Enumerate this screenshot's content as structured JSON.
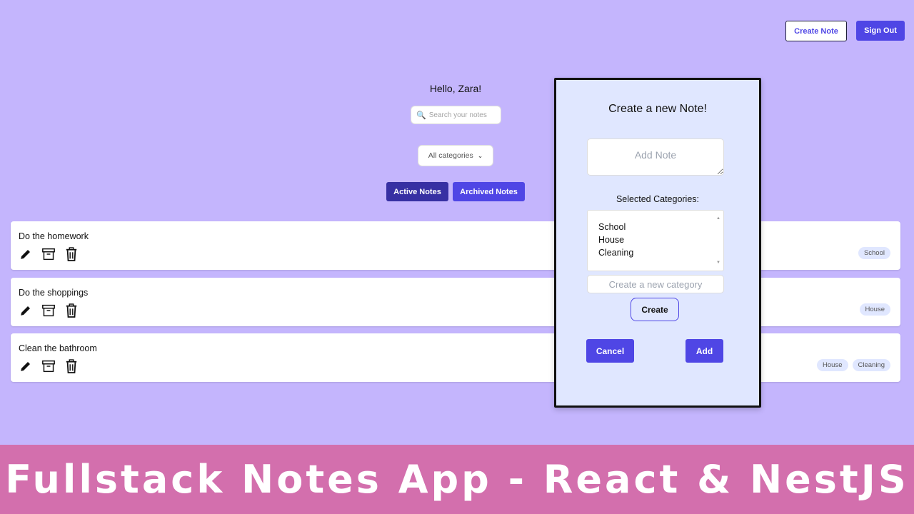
{
  "header": {
    "create_note_label": "Create Note",
    "sign_out_label": "Sign Out"
  },
  "greeting": "Hello, Zara!",
  "search": {
    "placeholder": "Search your notes",
    "icon": "search-icon"
  },
  "category_filter": {
    "selected": "All categories"
  },
  "tabs": [
    {
      "label": "Active Notes",
      "active": true
    },
    {
      "label": "Archived Notes",
      "active": false
    }
  ],
  "notes": [
    {
      "title": "Do the homework",
      "tags": [
        "School"
      ]
    },
    {
      "title": "Do the shoppings",
      "tags": [
        "House"
      ]
    },
    {
      "title": "Clean the bathroom",
      "tags": [
        "House",
        "Cleaning"
      ]
    }
  ],
  "modal": {
    "title": "Create a new Note!",
    "note_placeholder": "Add Note",
    "categories_label": "Selected Categories:",
    "categories": [
      "School",
      "House",
      "Cleaning"
    ],
    "new_category_placeholder": "Create a new category",
    "create_label": "Create",
    "cancel_label": "Cancel",
    "add_label": "Add"
  },
  "banner": {
    "text": "Fullstack Notes App - React & NestJS"
  },
  "colors": {
    "background": "#c4b5fd",
    "primary": "#4f46e5",
    "primary_dark": "#3730a3",
    "modal_bg": "#e0e7ff",
    "banner": "#d36fad"
  }
}
